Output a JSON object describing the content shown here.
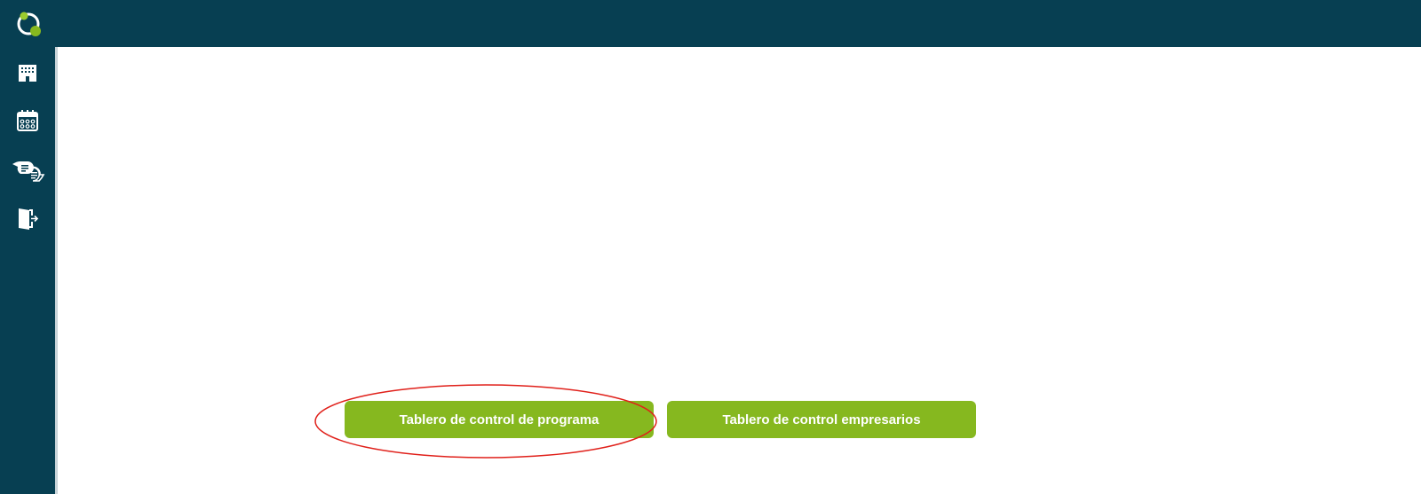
{
  "header": {
    "background_color": "#073f52"
  },
  "sidebar": {
    "logo_icon": "app-logo-icon",
    "items": [
      {
        "icon": "building-icon"
      },
      {
        "icon": "calendar-icon"
      },
      {
        "icon": "chat-bubbles-icon"
      },
      {
        "icon": "logout-door-icon"
      }
    ]
  },
  "main": {
    "buttons": {
      "program_dashboard": "Tablero de control de programa",
      "business_dashboard": "Tablero de control empresarios"
    },
    "button_color": "#86b81f"
  },
  "annotation": {
    "shape": "ellipse",
    "color": "#e0201a",
    "target": "program_dashboard"
  }
}
